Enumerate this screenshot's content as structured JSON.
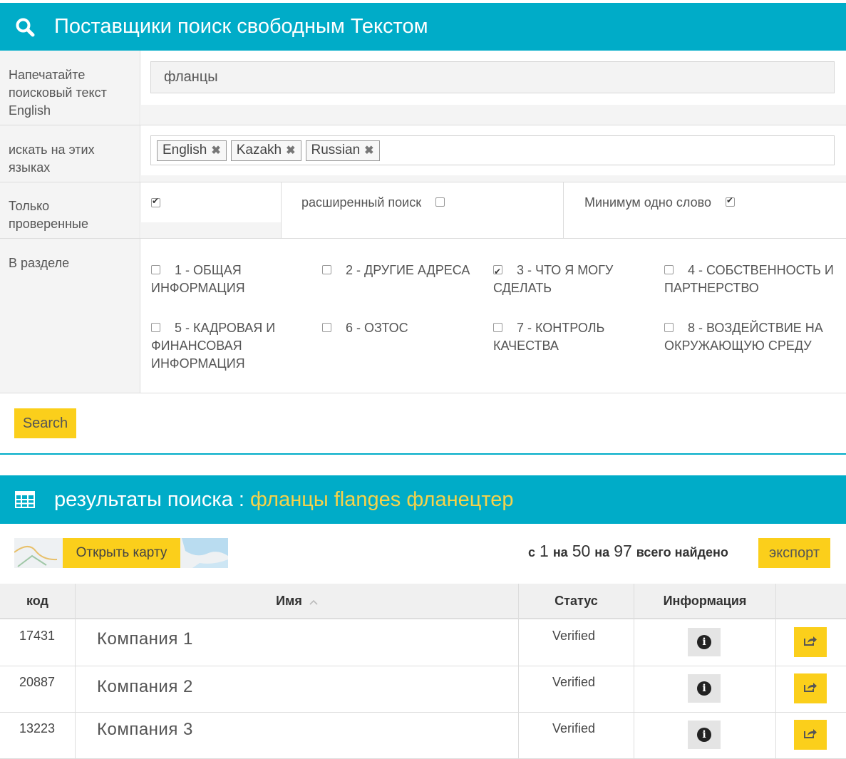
{
  "search_header": {
    "title": "Поставщики поиск свободным Текстом",
    "icon": "search-icon"
  },
  "form": {
    "text_label": "Напечатайте поисковый текст English",
    "text_value": "фланцы",
    "lang_label": "искать на этих языках",
    "languages": [
      "English",
      "Kazakh",
      "Russian"
    ],
    "verified_label": "Только проверенные",
    "verified_checked": true,
    "advanced_label": "расширенный поиск",
    "advanced_checked": false,
    "min_word_label": "Минимум одно слово",
    "min_word_checked": true,
    "section_label": "В разделе",
    "sections": [
      {
        "label": "1 - ОБЩАЯ ИНФОРМАЦИЯ",
        "checked": false
      },
      {
        "label": "2 - ДРУГИЕ АДРЕСА",
        "checked": false
      },
      {
        "label": "3 - ЧТО Я МОГУ СДЕЛАТЬ",
        "checked": true
      },
      {
        "label": "4 - СОБСТВЕННОСТЬ И ПАРТНЕРСТВО",
        "checked": false
      },
      {
        "label": "5 - КАДРОВАЯ И ФИНАНСОВАЯ ИНФОРМАЦИЯ",
        "checked": false
      },
      {
        "label": "6 - ОЗТОС",
        "checked": false
      },
      {
        "label": "7 - КОНТРОЛЬ КАЧЕСТВА",
        "checked": false
      },
      {
        "label": "8 - ВОЗДЕЙСТВИЕ НА ОКРУЖАЮЩУЮ СРЕДУ",
        "checked": false
      }
    ],
    "search_button": "Search"
  },
  "results_header": {
    "title": "результаты поиска :",
    "query": "фланцы flanges фланецтер",
    "icon": "table-icon"
  },
  "toolbar": {
    "map_button": "Открыть карту",
    "pag_from_label": "с",
    "pag_from": "1",
    "pag_to_label": "на",
    "pag_to": "50",
    "pag_total_label": "на",
    "pag_total": "97",
    "pag_found_label": "всего найдено",
    "export_button": "экспорт"
  },
  "table": {
    "columns": [
      "код",
      "Имя",
      "Статус",
      "Информация"
    ],
    "sort_icon": "sort-up-icon",
    "rows": [
      {
        "code": "17431",
        "name": "Компания 1",
        "status": "Verified"
      },
      {
        "code": "20887",
        "name": "Компания 2",
        "status": "Verified"
      },
      {
        "code": "13223",
        "name": "Компания 3",
        "status": "Verified"
      }
    ]
  },
  "colors": {
    "accent": "#00acc8",
    "button": "#fbcf1b",
    "highlight": "#f6d24a"
  }
}
